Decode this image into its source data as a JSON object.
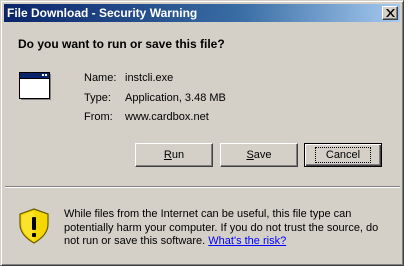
{
  "window": {
    "title": "File Download - Security Warning",
    "close_glyph": "close-icon"
  },
  "prompt": "Do you want to run or save this file?",
  "file": {
    "icon": "application-window-icon",
    "name_label": "Name:",
    "name_value": "instcli.exe",
    "type_label": "Type:",
    "type_value": "Application, 3.48 MB",
    "from_label": "From:",
    "from_value": "www.cardbox.net"
  },
  "buttons": {
    "run_accel": "R",
    "run_rest": "un",
    "save_accel": "S",
    "save_rest": "ave",
    "cancel": "Cancel"
  },
  "warning": {
    "icon": "shield-warning-icon",
    "text": "While files from the Internet can be useful, this file type can potentially harm your computer. If you do not trust the source, do not run or save this software. ",
    "link": "What's the risk?"
  },
  "colors": {
    "dialog_bg": "#d4d0c8",
    "title_gradient_start": "#0a246a",
    "title_gradient_end": "#a6caf0",
    "link": "#0000ff",
    "shield_yellow": "#f5d800"
  }
}
